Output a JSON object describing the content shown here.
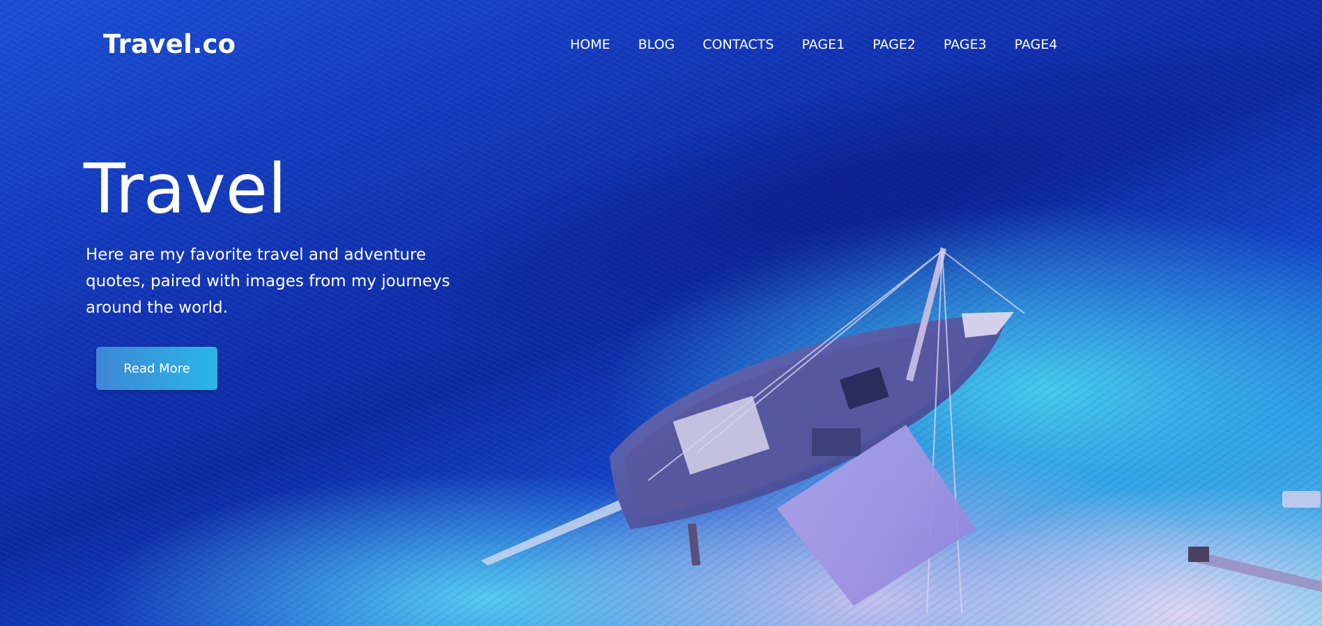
{
  "header": {
    "logo": "Travel.co",
    "nav": [
      {
        "label": "HOME"
      },
      {
        "label": "BLOG"
      },
      {
        "label": "CONTACTS"
      },
      {
        "label": "PAGE1"
      },
      {
        "label": "PAGE2"
      },
      {
        "label": "PAGE3"
      },
      {
        "label": "PAGE4"
      }
    ]
  },
  "hero": {
    "title": "Travel",
    "text": "Here are my favorite travel and adventure quotes, paired with images from my journeys around the world.",
    "button_label": "Read More",
    "background": "aerial-ocean-beach-boat-photo"
  },
  "colors": {
    "deep_ocean": "#0d2aa3",
    "shallow_water": "#46d2f0",
    "sand": "#e6d7f5",
    "button_start": "#3e86d6",
    "button_end": "#2ab6e6",
    "text": "#ffffff"
  }
}
